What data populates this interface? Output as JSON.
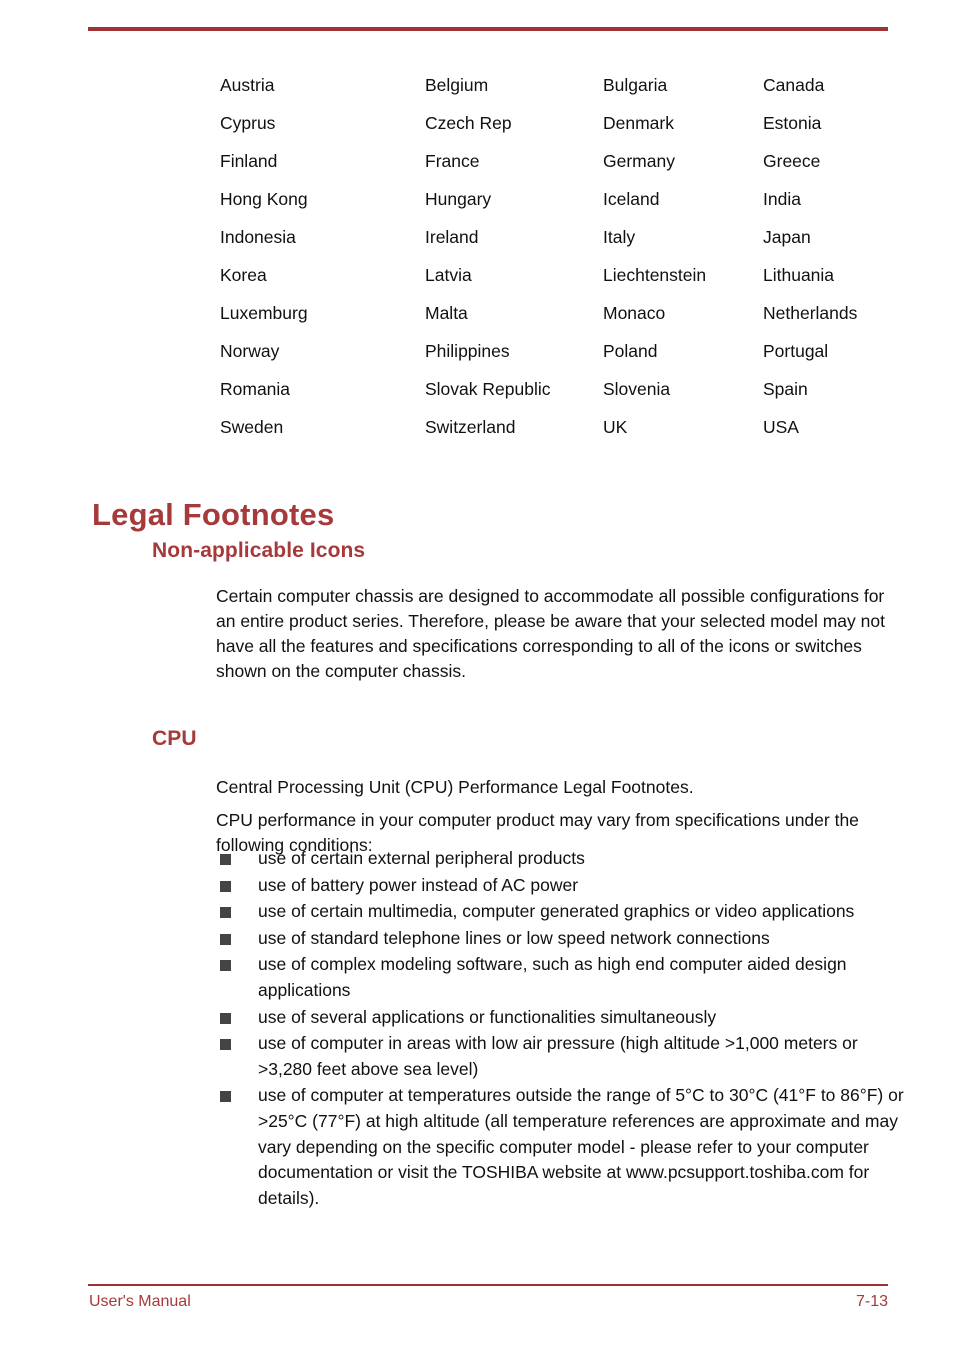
{
  "page": {
    "accent_color": "#a6393a",
    "rule_color": "#9e3234",
    "bullet_color": "#444444",
    "body_color": "#111111"
  },
  "country_table": {
    "columns": 4,
    "rows": [
      [
        "Austria",
        "Belgium",
        "Bulgaria",
        "Canada"
      ],
      [
        "Cyprus",
        "Czech Rep",
        "Denmark",
        "Estonia"
      ],
      [
        "Finland",
        "France",
        "Germany",
        "Greece"
      ],
      [
        "Hong Kong",
        "Hungary",
        "Iceland",
        "India"
      ],
      [
        "Indonesia",
        "Ireland",
        "Italy",
        "Japan"
      ],
      [
        "Korea",
        "Latvia",
        "Liechtenstein",
        "Lithuania"
      ],
      [
        "Luxemburg",
        "Malta",
        "Monaco",
        "Netherlands"
      ],
      [
        "Norway",
        "Philippines",
        "Poland",
        "Portugal"
      ],
      [
        "Romania",
        "Slovak Republic",
        "Slovenia",
        "Spain"
      ],
      [
        "Sweden",
        "Switzerland",
        "UK",
        "USA"
      ]
    ]
  },
  "sections": {
    "legal_footnotes_heading": "Legal Footnotes",
    "non_applicable_icons_heading": "Non-applicable Icons",
    "non_applicable_icons_body": "Certain computer chassis are designed to accommodate all possible configurations for an entire product series. Therefore, please be aware that your selected model may not have all the features and specifications corresponding to all of the icons or switches shown on the computer chassis.",
    "cpu_heading": "CPU",
    "cpu_paragraph_1": "Central Processing Unit (CPU) Performance Legal Footnotes.",
    "cpu_paragraph_2": "CPU performance in your computer product may vary from specifications under the following conditions:",
    "cpu_conditions": [
      "use of certain external peripheral products",
      "use of battery power instead of AC power",
      "use of certain multimedia, computer generated graphics or video applications",
      "use of standard telephone lines or low speed network connections",
      "use of complex modeling software, such as high end computer aided design applications",
      "use of several applications or functionalities simultaneously",
      "use of computer in areas with low air pressure (high altitude >1,000 meters or >3,280 feet above sea level)",
      "use of computer at temperatures outside the range of 5°C to 30°C (41°F to 86°F) or >25°C (77°F) at high altitude (all temperature references are approximate and may vary depending on the specific computer model - please refer to your computer documentation or visit the TOSHIBA website at www.pcsupport.toshiba.com for details)."
    ]
  },
  "footer": {
    "left_label": "User's Manual",
    "page_number": "7-13"
  }
}
